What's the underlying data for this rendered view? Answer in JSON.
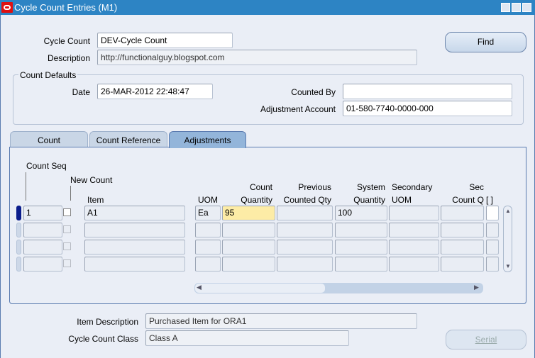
{
  "window": {
    "title": "Cycle Count Entries (M1)"
  },
  "header": {
    "cycle_count_label": "Cycle Count",
    "cycle_count_value": "DEV-Cycle Count",
    "description_label": "Description",
    "description_value": "http://functionalguy.blogspot.com",
    "find_label": "Find"
  },
  "defaults": {
    "legend": "Count Defaults",
    "date_label": "Date",
    "date_value": "26-MAR-2012 22:48:47",
    "counted_by_label": "Counted By",
    "counted_by_value": "",
    "adjustment_account_label": "Adjustment Account",
    "adjustment_account_value": "01-580-7740-0000-000"
  },
  "tabs": [
    {
      "label": "Count"
    },
    {
      "label": "Count Reference"
    },
    {
      "label": "Adjustments",
      "active": true
    }
  ],
  "columns": {
    "count_seq": "Count Seq",
    "new_count": "New Count",
    "item": "Item",
    "uom": "UOM",
    "count_qty_1": "Count",
    "count_qty_2": "Quantity",
    "prev_1": "Previous",
    "prev_2": "Counted Qty",
    "sys_1": "System",
    "sys_2": "Quantity",
    "sec_uom_1": "Secondary",
    "sec_uom_2": "UOM",
    "sec_count_1": "Sec",
    "sec_count_2": "Count Q",
    "flex": "[  ]"
  },
  "rows": [
    {
      "seq": "1",
      "new_count": false,
      "item": "A1",
      "uom": "Ea",
      "count_qty": "95",
      "prev_qty": "",
      "system_qty": "100",
      "sec_uom": "",
      "sec_count": ""
    },
    {
      "seq": "",
      "item": "",
      "uom": "",
      "count_qty": "",
      "prev_qty": "",
      "system_qty": "",
      "sec_uom": "",
      "sec_count": ""
    },
    {
      "seq": "",
      "item": "",
      "uom": "",
      "count_qty": "",
      "prev_qty": "",
      "system_qty": "",
      "sec_uom": "",
      "sec_count": ""
    },
    {
      "seq": "",
      "item": "",
      "uom": "",
      "count_qty": "",
      "prev_qty": "",
      "system_qty": "",
      "sec_uom": "",
      "sec_count": ""
    }
  ],
  "footer": {
    "item_description_label": "Item Description",
    "item_description_value": "Purchased Item for ORA1",
    "class_label": "Cycle Count Class",
    "class_value": "Class A",
    "serial_label": "Serial"
  },
  "colors": {
    "titlebar": "#2d84c4",
    "background": "#eaeef6",
    "active_field": "#fdeca6",
    "active_tab": "#93b5da"
  }
}
